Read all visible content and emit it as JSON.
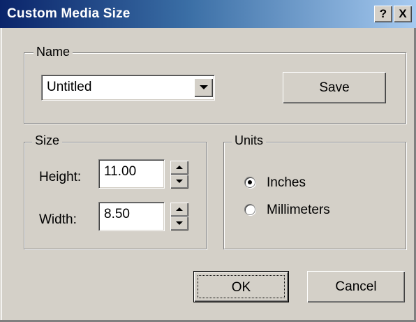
{
  "window": {
    "title": "Custom Media Size",
    "help_label": "?",
    "close_label": "X"
  },
  "name_group": {
    "legend": "Name",
    "selected_value": "Untitled",
    "save_label": "Save"
  },
  "size_group": {
    "legend": "Size",
    "height_label": "Height:",
    "height_value": "11.00",
    "width_label": "Width:",
    "width_value": "8.50"
  },
  "units_group": {
    "legend": "Units",
    "options": [
      {
        "label": "Inches",
        "selected": true
      },
      {
        "label": "Millimeters",
        "selected": false
      }
    ]
  },
  "buttons": {
    "ok_label": "OK",
    "cancel_label": "Cancel"
  }
}
